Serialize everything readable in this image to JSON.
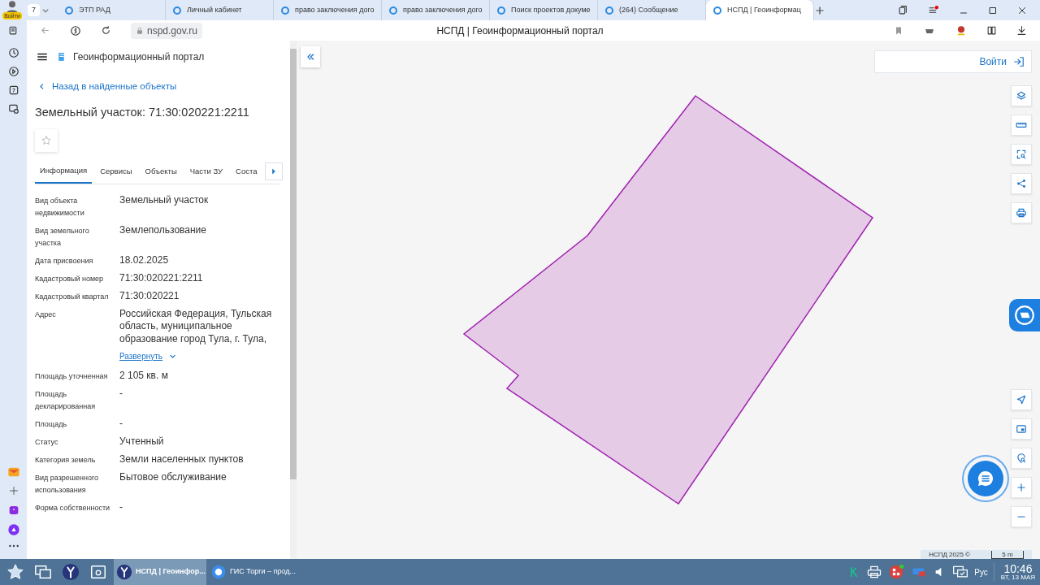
{
  "browser": {
    "profile_label": "Войти",
    "tab_count": "7",
    "url": "nspd.gov.ru",
    "page_title": "НСПД | Геоинформационный портал",
    "tabs": [
      {
        "title": "ЭТП РАД",
        "selected": false
      },
      {
        "title": "Личный кабинет",
        "selected": false
      },
      {
        "title": "право заключения дого",
        "selected": false
      },
      {
        "title": "право заключения дого",
        "selected": false
      },
      {
        "title": "Поиск проектов докуме",
        "selected": false
      },
      {
        "title": "(264) Сообщение",
        "selected": false
      },
      {
        "title": "НСПД | Геоинформац",
        "selected": true
      }
    ]
  },
  "panel": {
    "portal_name": "Геоинформационный портал",
    "back_link": "Назад в найденные объекты",
    "title": "Земельный участок: 71:30:020221:2211",
    "tabs": [
      {
        "label": "Информация",
        "selected": true
      },
      {
        "label": "Сервисы",
        "selected": false
      },
      {
        "label": "Объекты",
        "selected": false
      },
      {
        "label": "Части ЗУ",
        "selected": false
      },
      {
        "label": "Соста",
        "selected": false
      }
    ],
    "fields": [
      {
        "label": "Вид объекта недвижимости",
        "value": "Земельный участок"
      },
      {
        "label": "Вид земельного участка",
        "value": "Землепользование"
      },
      {
        "label": "Дата присвоения",
        "value": "18.02.2025"
      },
      {
        "label": "Кадастровый номер",
        "value": "71:30:020221:2211"
      },
      {
        "label": "Кадастровый квартал",
        "value": "71:30:020221"
      },
      {
        "label": "Адрес",
        "value": "Российская Федерация, Тульская область, муниципальное образование город Тула, г. Тула,",
        "expand_link": "Развернуть"
      },
      {
        "label": "Площадь уточненная",
        "value": "2 105 кв. м"
      },
      {
        "label": "Площадь декларированная",
        "value": "-"
      },
      {
        "label": "Площадь",
        "value": "-"
      },
      {
        "label": "Статус",
        "value": "Учтенный"
      },
      {
        "label": "Категория земель",
        "value": "Земли населенных пунктов"
      },
      {
        "label": "Вид разрешенного использования",
        "value": "Бытовое обслуживание"
      },
      {
        "label": "Форма собственности",
        "value": "-"
      }
    ]
  },
  "map": {
    "login_button": "Войти",
    "attribution": "НСПД 2025 ©",
    "scale": "5 m"
  },
  "taskbar": {
    "tasks": [
      {
        "title": "НСПД | Геоинфор...",
        "selected": true
      },
      {
        "title": "ГИС Торги – прод...",
        "selected": false
      }
    ],
    "language": "Рус",
    "time": "10:46",
    "date": "ВТ, 13 МАЯ"
  }
}
